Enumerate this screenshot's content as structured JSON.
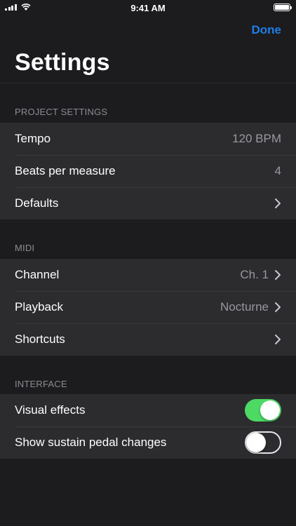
{
  "status_bar": {
    "time": "9:41 AM"
  },
  "nav": {
    "done_label": "Done",
    "title": "Settings"
  },
  "colors": {
    "accent": "#1e7ee8",
    "toggle_on": "#4cd964",
    "background": "#1c1c1e",
    "cell": "#2c2c2e"
  },
  "sections": [
    {
      "header": "PROJECT SETTINGS",
      "rows": [
        {
          "label": "Tempo",
          "value": "120 BPM"
        },
        {
          "label": "Beats per measure",
          "value": "4"
        },
        {
          "label": "Defaults",
          "value": "",
          "icon": "chevron-right-icon"
        }
      ]
    },
    {
      "header": "MIDI",
      "rows": [
        {
          "label": "Channel",
          "value": "Ch. 1",
          "icon": "chevron-right-icon"
        },
        {
          "label": "Playback",
          "value": "Nocturne",
          "icon": "chevron-right-icon"
        },
        {
          "label": "Shortcuts",
          "value": "",
          "icon": "chevron-right-icon"
        }
      ]
    },
    {
      "header": "INTERFACE",
      "rows": [
        {
          "label": "Visual effects",
          "toggle": true
        },
        {
          "label": "Show sustain pedal changes",
          "toggle": false
        }
      ]
    }
  ]
}
